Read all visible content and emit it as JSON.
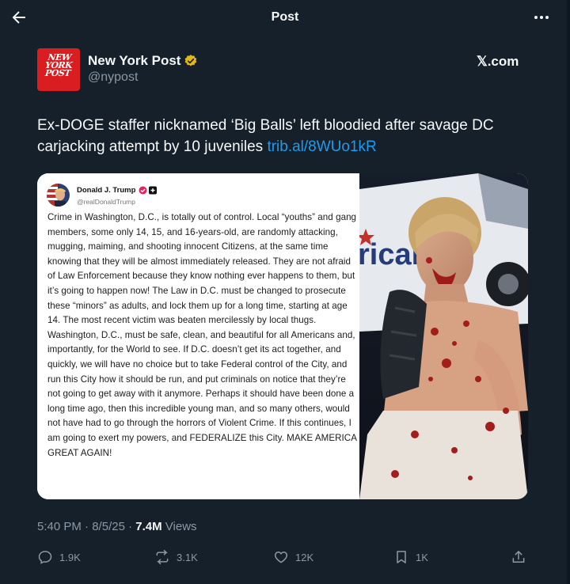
{
  "header": {
    "title": "Post"
  },
  "author": {
    "avatar_text": [
      "NEW",
      "YORK",
      "POST"
    ],
    "name": "New York Post",
    "handle": "@nypost",
    "source_label": "𝕏.com"
  },
  "tweet": {
    "text": "Ex-DOGE staffer nicknamed ‘Big Balls’ left bloodied after savage DC carjacking attempt by 10 juveniles ",
    "link": "trib.al/8WUo1kR"
  },
  "embedded_post": {
    "name": "Donald J. Trump",
    "handle": "@realDonaldTrump",
    "body": "Crime in Washington, D.C., is totally out of control. Local “youths” and gang members, some only 14, 15, and 16-years-old, are randomly attacking, mugging, maiming, and shooting innocent Citizens, at the same time knowing that they will be almost immediately released. They are not afraid of Law Enforcement because they know nothing ever happens to them, but it’s going to happen now! The Law in D.C. must be changed to prosecute these “minors” as adults, and lock them up for a long time, starting at age 14. The most recent victim was beaten mercilessly by local thugs. Washington, D.C., must be safe, clean, and beautiful for all Americans and, importantly, for the World to see. If D.C. doesn’t get its act together, and quickly, we will have no choice but to take Federal control of the City, and run this City how it should be run, and put criminals on notice that they’re not going to get away with it anymore. Perhaps it should have been done a long time ago, then this incredible young man, and so many others, would not have had to go through the horrors of Violent Crime. If this continues, I am going to exert my powers, and FEDERALIZE this City. MAKE AMERICA GREAT AGAIN!",
    "photo_sign_text": "rican"
  },
  "meta": {
    "time": "5:40 PM",
    "separator": " · ",
    "date": "8/5/25",
    "views_count": "7.4M",
    "views_label": " Views"
  },
  "actions": {
    "replies": "1.9K",
    "reposts": "3.1K",
    "likes": "12K",
    "bookmarks": "1K"
  },
  "colors": {
    "background": "#15202b",
    "link": "#1d9bf0",
    "muted": "#8b98a5",
    "verified_gold": "#e2b719",
    "nypost_red": "#d91d21"
  }
}
